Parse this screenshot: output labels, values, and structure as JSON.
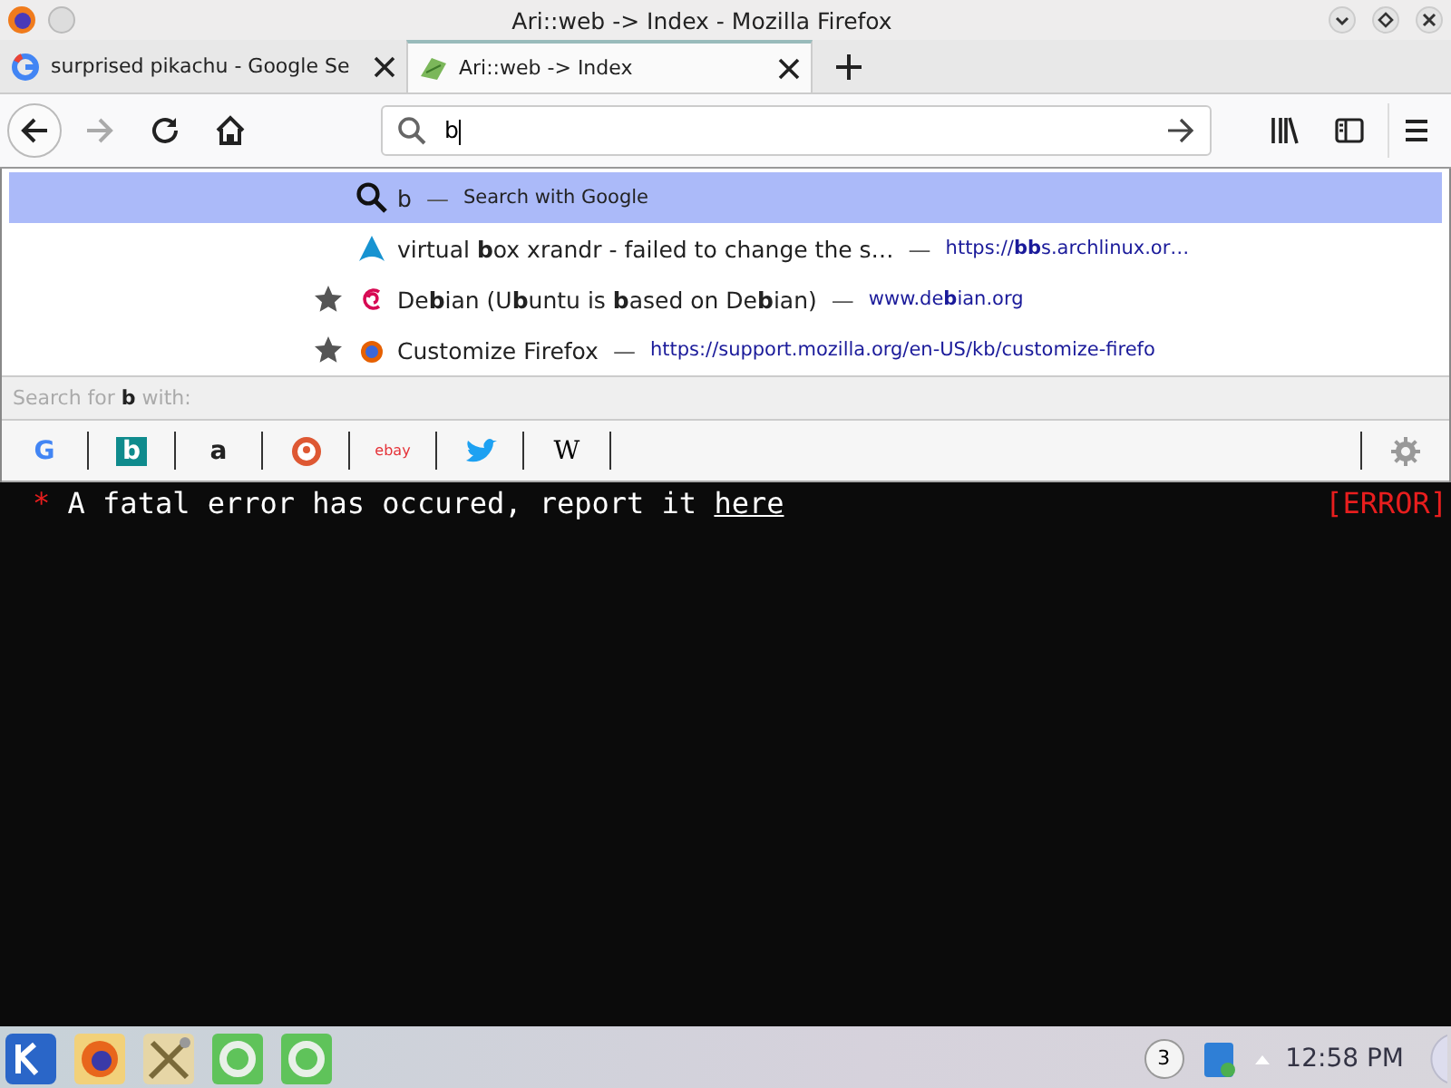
{
  "window": {
    "title": "Ari::web -> Index - Mozilla Firefox"
  },
  "tabs": [
    {
      "label": "surprised pikachu - Google Se",
      "selected": false
    },
    {
      "label": "Ari::web -> Index",
      "selected": true
    }
  ],
  "url_field": {
    "value": "b"
  },
  "results": [
    {
      "kind": "search",
      "title": "b",
      "separator": "—",
      "action": "Search with Google",
      "starred": false,
      "selected": true
    },
    {
      "kind": "site",
      "title": "virtual **b**ox xrandr - failed to change the s…",
      "separator": "—",
      "url": "https://**bb**s.archlinux.or…",
      "starred": false,
      "selected": false
    },
    {
      "kind": "site",
      "title": "De**b**ian (U**b**untu is **b**ased on De**b**ian)",
      "separator": "—",
      "url": "www.de**b**ian.org",
      "starred": true,
      "selected": false
    },
    {
      "kind": "site",
      "title": "Customize Firefox",
      "separator": "—",
      "url": "https://support.mozilla.org/en-US/kb/customize-firefo",
      "starred": true,
      "selected": false
    }
  ],
  "search_with": "Search for **b** with:",
  "engines": [
    {
      "kind": "glyph",
      "glyph": "G"
    },
    {
      "kind": "glyph",
      "glyph": "b"
    },
    {
      "kind": "glyph",
      "glyph": "a"
    },
    {
      "kind": "duck"
    },
    {
      "kind": "glyph",
      "glyph": "ebay"
    },
    {
      "kind": "bird"
    },
    {
      "kind": "glyph",
      "glyph": "W"
    }
  ],
  "content": {
    "bullet": "*",
    "message": "A fatal error has occured, report it",
    "link": "here",
    "status": "[ERROR]"
  },
  "taskbar": {
    "desktop": "3",
    "clock": "12:58 PM"
  }
}
